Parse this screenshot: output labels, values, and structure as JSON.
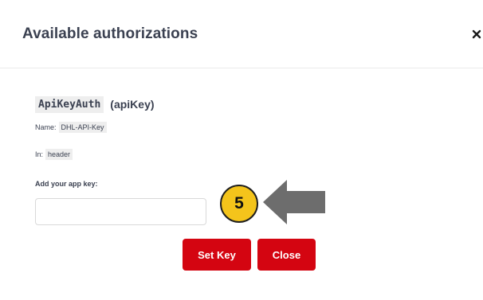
{
  "modal": {
    "title": "Available authorizations",
    "close_icon": "close-x-icon"
  },
  "scheme": {
    "name": "ApiKeyAuth",
    "type": "(apiKey)",
    "name_label": "Name:",
    "name_value": "DHL-API-Key",
    "in_label": "In:",
    "in_value": "header"
  },
  "form": {
    "field_label": "Add your app key:",
    "input_value": "",
    "input_placeholder": ""
  },
  "buttons": {
    "set_key": "Set Key",
    "close": "Close"
  },
  "annotation": {
    "step_number": "5",
    "arrow_icon": "left-arrow-icon",
    "badge_color": "#f4c41b",
    "arrow_color": "#6d6d6d"
  },
  "colors": {
    "accent": "#d40511",
    "text": "#3b4151",
    "code_bg": "#eeeeee"
  }
}
